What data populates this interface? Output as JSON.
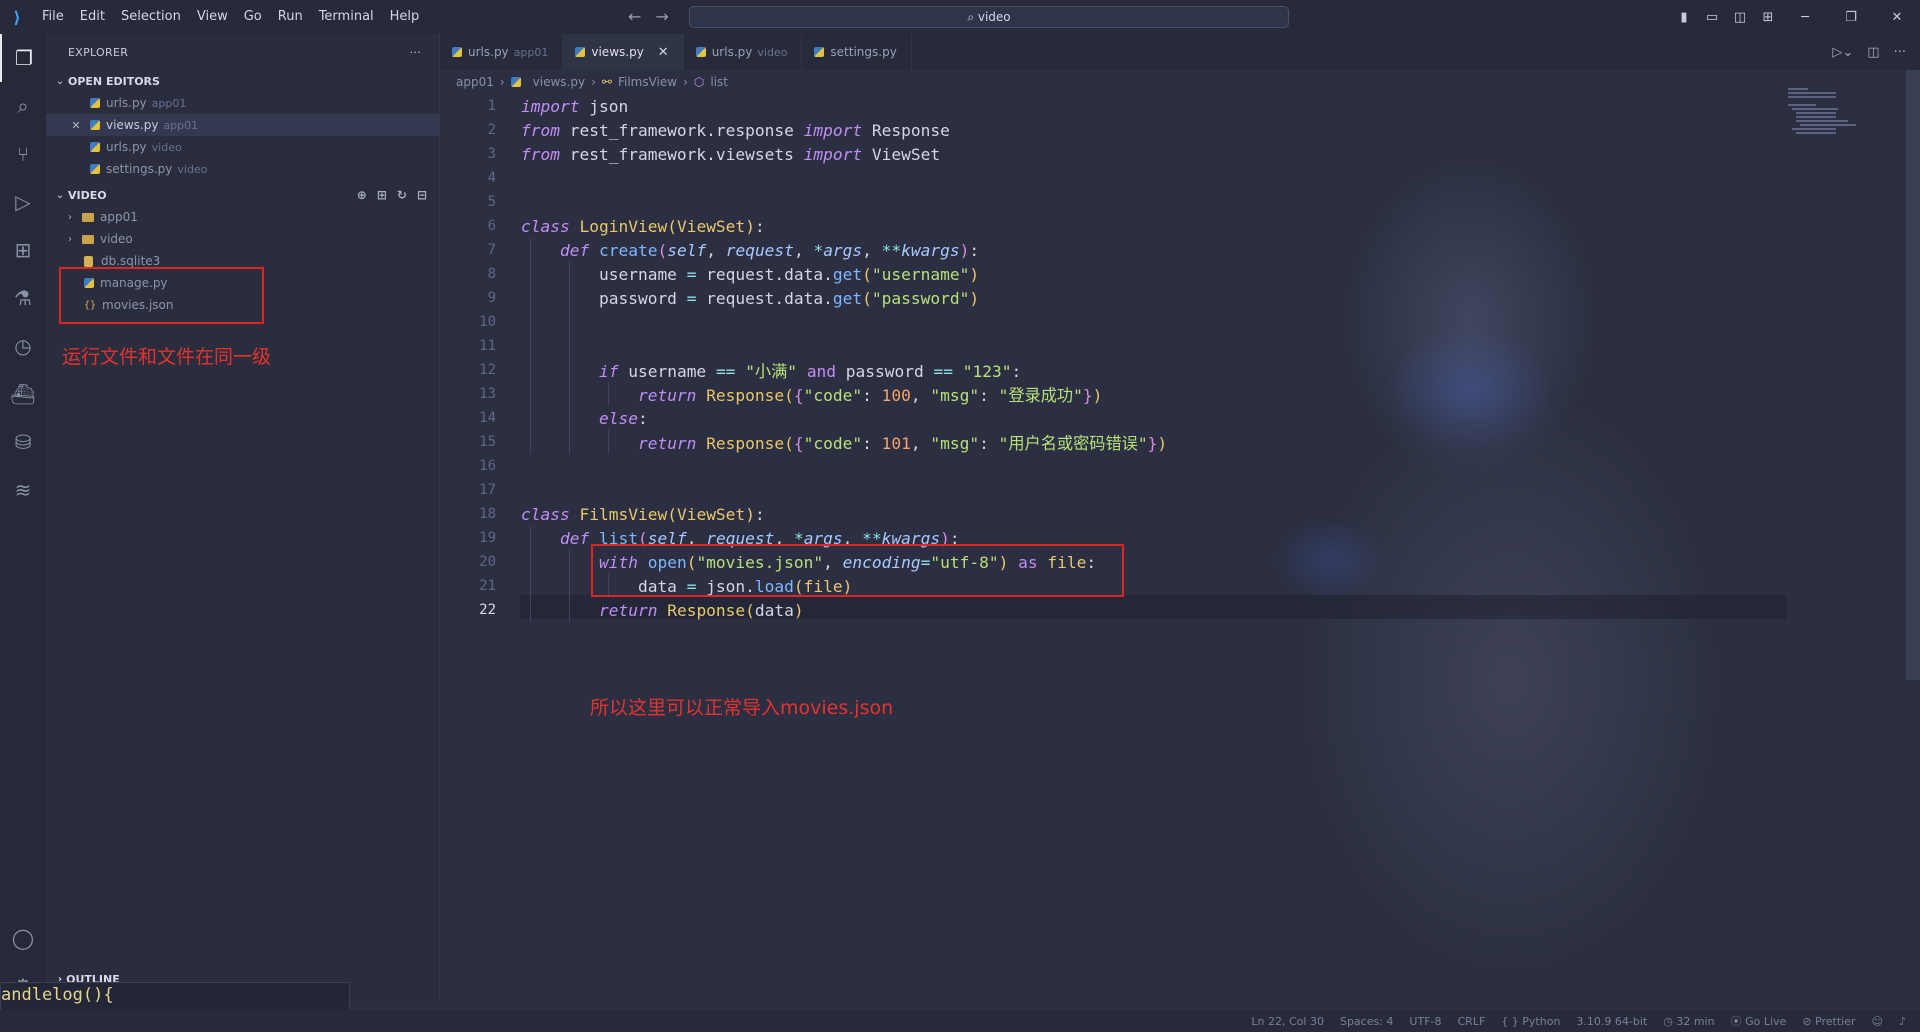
{
  "titlebar": {
    "menu": [
      "File",
      "Edit",
      "Selection",
      "View",
      "Go",
      "Run",
      "Terminal",
      "Help"
    ],
    "search": "video"
  },
  "explorer": {
    "header": "EXPLORER",
    "more": "···",
    "open_editors_title": "OPEN EDITORS",
    "open_editors": [
      {
        "name": "urls.py",
        "hint": "app01"
      },
      {
        "name": "views.py",
        "hint": "app01"
      },
      {
        "name": "urls.py",
        "hint": "video"
      },
      {
        "name": "settings.py",
        "hint": "video"
      }
    ],
    "project_title": "VIDEO",
    "tree": [
      {
        "name": "app01",
        "kind": "folder"
      },
      {
        "name": "video",
        "kind": "folder"
      },
      {
        "name": "db.sqlite3",
        "kind": "db"
      },
      {
        "name": "manage.py",
        "kind": "py"
      },
      {
        "name": "movies.json",
        "kind": "json"
      }
    ],
    "outline_title": "OUTLINE"
  },
  "annotations": {
    "left_note": "运行文件和文件在同一级",
    "right_note": "所以这里可以正常导入movies.json"
  },
  "tabs": [
    {
      "name": "urls.py",
      "hint": "app01"
    },
    {
      "name": "views.py",
      "hint": ""
    },
    {
      "name": "urls.py",
      "hint": "video"
    },
    {
      "name": "settings.py",
      "hint": ""
    }
  ],
  "breadcrumb": [
    "app01",
    "views.py",
    "FilmsView",
    "list"
  ],
  "code_strings": {
    "username": "\"username\"",
    "password": "\"password\"",
    "xiaoman": "\"小满\"",
    "pwd": "\"123\"",
    "code": "\"code\"",
    "msg": "\"msg\"",
    "ok": "\"登录成功\"",
    "err": "\"用户名或密码错误\"",
    "movies": "\"movies.json\"",
    "utf8": "\"utf-8\""
  },
  "statusbar": {
    "position": "Ln 22, Col 30",
    "spaces": "Spaces: 4",
    "encoding": "UTF-8",
    "eol": "CRLF",
    "lang": "Python",
    "interpreter": "3.10.9 64-bit",
    "time": "32 min",
    "golive": "Go Live",
    "prettier": "Prettier"
  },
  "panel_text": "andlelog(){"
}
